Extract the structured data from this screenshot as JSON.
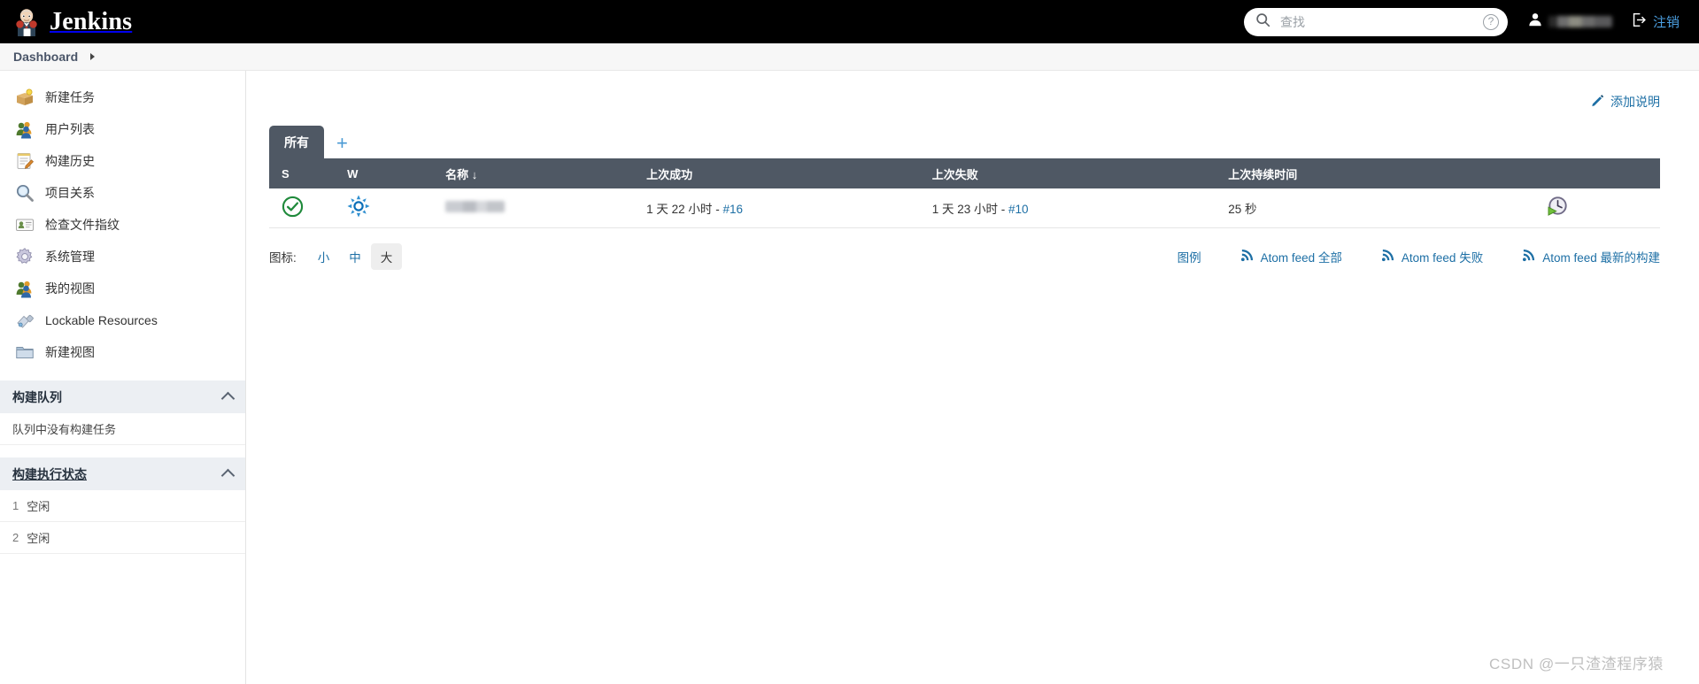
{
  "header": {
    "brand": "Jenkins",
    "logo_icon": "jenkins-butler-logo",
    "search": {
      "placeholder": "查找",
      "value": "",
      "icon": "search-icon"
    },
    "help_icon": "question-mark-icon",
    "user": {
      "icon": "person-avatar-icon",
      "name_masked": true
    },
    "logout": {
      "label": "注销",
      "icon": "logout-icon"
    }
  },
  "breadcrumb": {
    "items": [
      "Dashboard"
    ],
    "caret_icon": "chevron-right-icon"
  },
  "sidebar": {
    "items": [
      {
        "label": "新建任务",
        "icon": "new-job-box-icon"
      },
      {
        "label": "用户列表",
        "icon": "people-icon"
      },
      {
        "label": "构建历史",
        "icon": "notepad-pencil-icon"
      },
      {
        "label": "项目关系",
        "icon": "magnifier-icon"
      },
      {
        "label": "检查文件指纹",
        "icon": "fingerprint-card-icon"
      },
      {
        "label": "系统管理",
        "icon": "gear-icon"
      },
      {
        "label": "我的视图",
        "icon": "people-icon"
      },
      {
        "label": "Lockable Resources",
        "icon": "usb-key-icon"
      },
      {
        "label": "新建视图",
        "icon": "folder-icon"
      }
    ],
    "build_queue": {
      "title": "构建队列",
      "collapse_icon": "chevron-up-icon",
      "empty_text": "队列中没有构建任务"
    },
    "build_executor_status": {
      "title": "构建执行状态",
      "collapse_icon": "chevron-up-icon",
      "executors": [
        {
          "num": "1",
          "status": "空闲"
        },
        {
          "num": "2",
          "status": "空闲"
        }
      ]
    }
  },
  "main": {
    "add_description": {
      "label": "添加说明",
      "icon": "pencil-icon"
    },
    "tabs": [
      {
        "label": "所有",
        "active": true
      }
    ],
    "add_tab_label": "+",
    "table": {
      "columns": [
        {
          "key": "s",
          "label": "S"
        },
        {
          "key": "w",
          "label": "W"
        },
        {
          "key": "name",
          "label": "名称",
          "sort_icon": "↓"
        },
        {
          "key": "last_success",
          "label": "上次成功"
        },
        {
          "key": "last_failure",
          "label": "上次失败"
        },
        {
          "key": "last_duration",
          "label": "上次持续时间"
        },
        {
          "key": "build",
          "label": ""
        }
      ],
      "rows": [
        {
          "status_icon": "success-check-circle-icon",
          "status_color": "#1f8a3b",
          "weather_icon": "sunny-weather-icon",
          "weather_color": "#0b6fb8",
          "name_masked": true,
          "last_success_time": "1 天 22 小时",
          "last_success_build": "#16",
          "last_failure_time": "1 天 23 小时",
          "last_failure_build": "#10",
          "last_duration": "25 秒",
          "build_button_icon": "schedule-build-clock-icon"
        }
      ]
    },
    "footer": {
      "icon_size_label": "图标:",
      "sizes": [
        {
          "label": "小",
          "active": false
        },
        {
          "label": "中",
          "active": false
        },
        {
          "label": "大",
          "active": true
        }
      ],
      "legend_label": "图例",
      "feeds": [
        {
          "label": "Atom feed 全部",
          "icon": "rss-icon"
        },
        {
          "label": "Atom feed 失败",
          "icon": "rss-icon"
        },
        {
          "label": "Atom feed 最新的构建",
          "icon": "rss-icon"
        }
      ]
    }
  },
  "watermark": "CSDN @一只渣渣程序猿",
  "colors": {
    "topbar_bg": "#000000",
    "header_table_bg": "#4f5864",
    "link_blue": "#1d6fa5",
    "success_green": "#1f8a3b",
    "section_bg": "#eceff3"
  }
}
